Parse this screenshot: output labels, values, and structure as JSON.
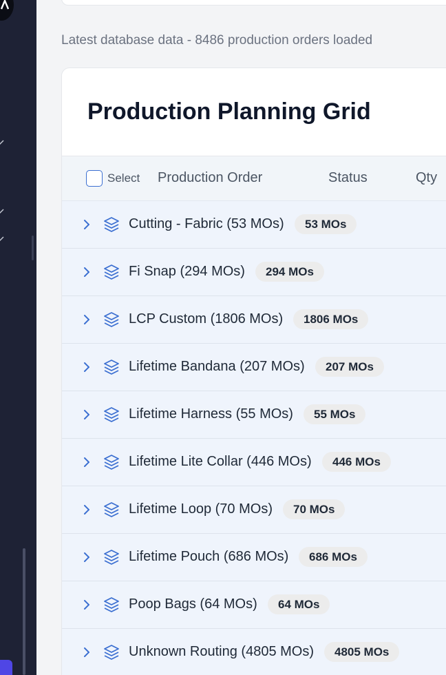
{
  "colors": {
    "sidebar": "#1e2235",
    "accent": "#3b6fd1",
    "row_bg": "#eff4fc",
    "badge_bg": "#ececec"
  },
  "status_text": "Latest database data - 8486 production orders loaded",
  "grid": {
    "title": "Production Planning Grid",
    "select_label": "Select",
    "columns": [
      "Production Order",
      "Status",
      "Qty"
    ],
    "groups": [
      {
        "name": "Cutting - Fabric (53 MOs)",
        "badge": "53 MOs",
        "icon": "layers-icon"
      },
      {
        "name": "Fi Snap (294 MOs)",
        "badge": "294 MOs",
        "icon": "layers-icon"
      },
      {
        "name": "LCP Custom (1806 MOs)",
        "badge": "1806 MOs",
        "icon": "layers-icon"
      },
      {
        "name": "Lifetime Bandana (207 MOs)",
        "badge": "207 MOs",
        "icon": "layers-icon"
      },
      {
        "name": "Lifetime Harness (55 MOs)",
        "badge": "55 MOs",
        "icon": "layers-icon"
      },
      {
        "name": "Lifetime Lite Collar (446 MOs)",
        "badge": "446 MOs",
        "icon": "layers-icon"
      },
      {
        "name": "Lifetime Loop (70 MOs)",
        "badge": "70 MOs",
        "icon": "layers-icon"
      },
      {
        "name": "Lifetime Pouch (686 MOs)",
        "badge": "686 MOs",
        "icon": "layers-icon"
      },
      {
        "name": "Poop Bags (64 MOs)",
        "badge": "64 MOs",
        "icon": "layers-icon"
      },
      {
        "name": "Unknown Routing (4805 MOs)",
        "badge": "4805 MOs",
        "icon": "layers-icon"
      }
    ]
  }
}
